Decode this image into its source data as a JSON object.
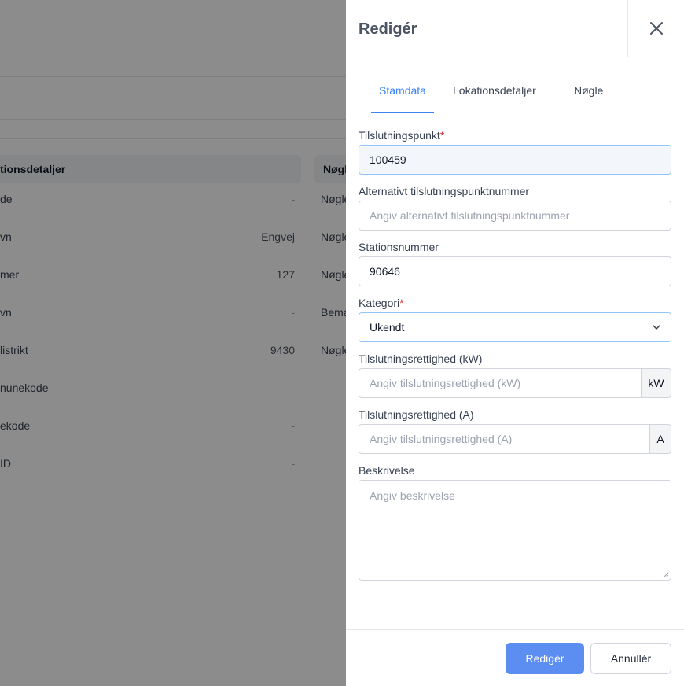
{
  "background": {
    "left_section_title": "tionsdetaljer",
    "right_section_title": "Nøgl",
    "left_rows": [
      {
        "label": "de",
        "value": "-"
      },
      {
        "label": "vn",
        "value": "Engvej"
      },
      {
        "label": "mer",
        "value": "127"
      },
      {
        "label": "vn",
        "value": "-"
      },
      {
        "label": "listrikt",
        "value": "9430"
      },
      {
        "label": "nunekode",
        "value": "-"
      },
      {
        "label": "ekode",
        "value": "-"
      },
      {
        "label": "ID",
        "value": "-"
      }
    ],
    "right_rows": [
      "Nøgle",
      "Nøgle",
      "Nøgle",
      "Bema",
      "Nøgle"
    ]
  },
  "drawer": {
    "title": "Redigér",
    "close_icon": "close-icon",
    "tabs": [
      {
        "label": "Stamdata",
        "active": true
      },
      {
        "label": "Lokationsdetaljer",
        "active": false
      },
      {
        "label": "Nøgle",
        "active": false
      }
    ],
    "fields": {
      "connection_point": {
        "label": "Tilslutningspunkt",
        "required_mark": "*",
        "value": "100459"
      },
      "alt_connection_point": {
        "label": "Alternativt tilslutningspunktnummer",
        "placeholder": "Angiv alternativt tilslutningspunktnummer"
      },
      "station_number": {
        "label": "Stationsnummer",
        "value": "90646"
      },
      "category": {
        "label": "Kategori",
        "required_mark": "*",
        "value": "Ukendt"
      },
      "connection_right_kw": {
        "label": "Tilslutningsrettighed (kW)",
        "placeholder": "Angiv tilslutningsrettighed (kW)",
        "unit": "kW"
      },
      "connection_right_a": {
        "label": "Tilslutningsrettighed (A)",
        "placeholder": "Angiv tilslutningsrettighed (A)",
        "unit": "A"
      },
      "description": {
        "label": "Beskrivelse",
        "placeholder": "Angiv beskrivelse"
      }
    },
    "footer": {
      "submit_label": "Redigér",
      "cancel_label": "Annullér"
    }
  },
  "colors": {
    "accent": "#3b82f6",
    "primary_button": "#5b8ef0",
    "required": "#dc2626"
  }
}
